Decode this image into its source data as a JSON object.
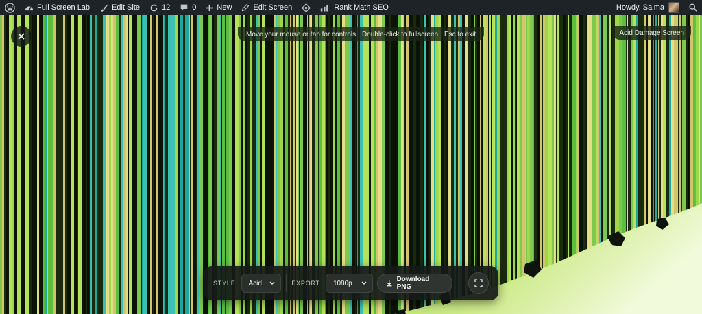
{
  "adminbar": {
    "site_name": "Full Screen Lab",
    "edit_site": "Edit Site",
    "updates_count": "12",
    "comments_count": "0",
    "new_label": "New",
    "edit_screen": "Edit Screen",
    "rank_math": "Rank Math SEO",
    "howdy": "Howdy, Salma"
  },
  "overlay": {
    "hint": "Move your mouse or tap for controls · Double-click to fullscreen · Esc to exit",
    "screen_name": "Acid Damage Screen",
    "close_icon": "close-icon"
  },
  "controls": {
    "style_label": "STYLE",
    "style_value": "Acid",
    "export_label": "EXPORT",
    "export_value": "1080p",
    "download_label": "Download PNG",
    "fullscreen_icon": "fullscreen-icon"
  },
  "colors": {
    "adminbar_bg": "#1d2327",
    "stripe_palette": [
      "#0b1206",
      "#1a2a0e",
      "#7ec850",
      "#b5e25a",
      "#1fa8a0",
      "#3cc0b4",
      "#d2c46a",
      "#e3de88",
      "#5bbf3d",
      "#9ed84a"
    ],
    "acid_gradient": [
      "#b9e46a",
      "#eef8d2"
    ]
  }
}
